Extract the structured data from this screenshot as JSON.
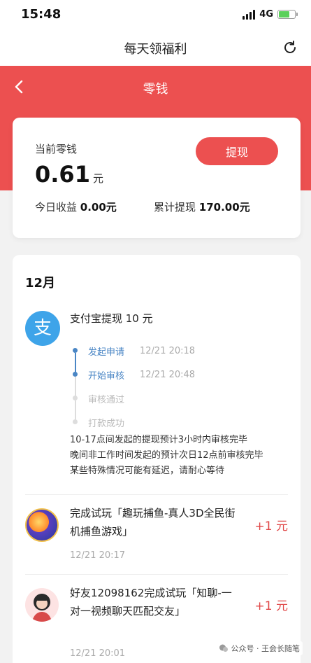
{
  "status_bar": {
    "time": "15:48",
    "network": "4G",
    "battery_level": 0.7
  },
  "header": {
    "title": "每天领福利",
    "refresh_icon": "refresh-icon"
  },
  "page": {
    "title": "零钱",
    "back_icon": "chevron-left-icon"
  },
  "balance": {
    "label": "当前零钱",
    "value": "0.61",
    "unit": "元",
    "withdraw_label": "提现",
    "today_label": "今日收益",
    "today_value": "0.00元",
    "total_label": "累计提现",
    "total_value": "170.00元"
  },
  "records": {
    "month": "12月",
    "withdrawal": {
      "title": "支付宝提现 10 元",
      "icon_glyph": "支",
      "steps": [
        {
          "label": "发起申请",
          "time": "12/21 20:18",
          "active": true
        },
        {
          "label": "开始审核",
          "time": "12/21 20:48",
          "active": true
        },
        {
          "label": "审核通过",
          "time": "",
          "active": false
        },
        {
          "label": "打款成功",
          "time": "",
          "active": false
        }
      ],
      "note": [
        "10-17点间发起的提现预计3小时内审核完毕",
        "晚间非工作时间发起的预计次日12点前审核完毕",
        "某些特殊情况可能有延迟，请耐心等待"
      ]
    },
    "items": [
      {
        "title": "完成试玩「趣玩捕鱼-真人3D全民街机捕鱼游戏」",
        "time": "12/21 20:17",
        "amount": "+1 元",
        "icon": "fishing-game-icon"
      },
      {
        "title": "好友12098162完成试玩「知聊-一对一视频聊天匹配交友」",
        "time": "12/21 20:01",
        "amount": "+1 元",
        "icon": "friend-avatar-icon"
      }
    ]
  },
  "watermark": {
    "text": "公众号 · 王会长随笔"
  },
  "colors": {
    "brand_red": "#ec5050",
    "link_blue": "#4a86c5",
    "alipay_blue": "#3ea4e9"
  }
}
